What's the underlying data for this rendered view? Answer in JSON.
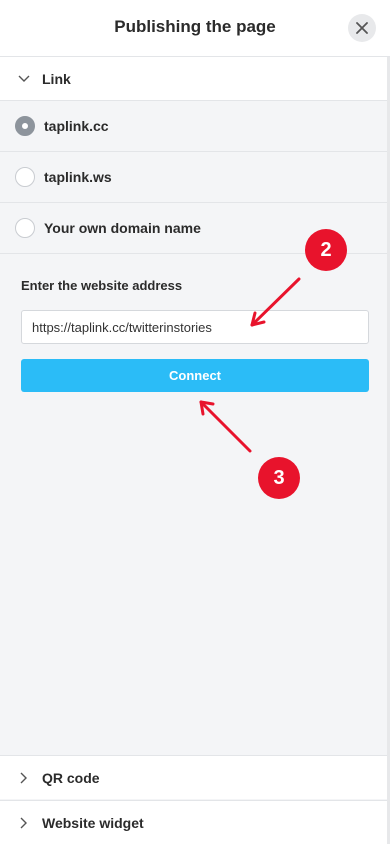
{
  "header": {
    "title": "Publishing the page"
  },
  "link_section": {
    "label": "Link"
  },
  "domains": [
    {
      "label": "taplink.cc",
      "checked": true
    },
    {
      "label": "taplink.ws",
      "checked": false
    },
    {
      "label": "Your own domain name",
      "checked": false
    }
  ],
  "form": {
    "label": "Enter the website address",
    "url_value": "https://taplink.cc/twitterinstories",
    "connect_label": "Connect"
  },
  "annotations": {
    "badge_2": "2",
    "badge_3": "3",
    "color": "#e8132c"
  },
  "sections": {
    "qr_code": "QR code",
    "website_widget": "Website widget"
  },
  "colors": {
    "accent": "#2bbcf7",
    "background": "#f4f5f7"
  }
}
